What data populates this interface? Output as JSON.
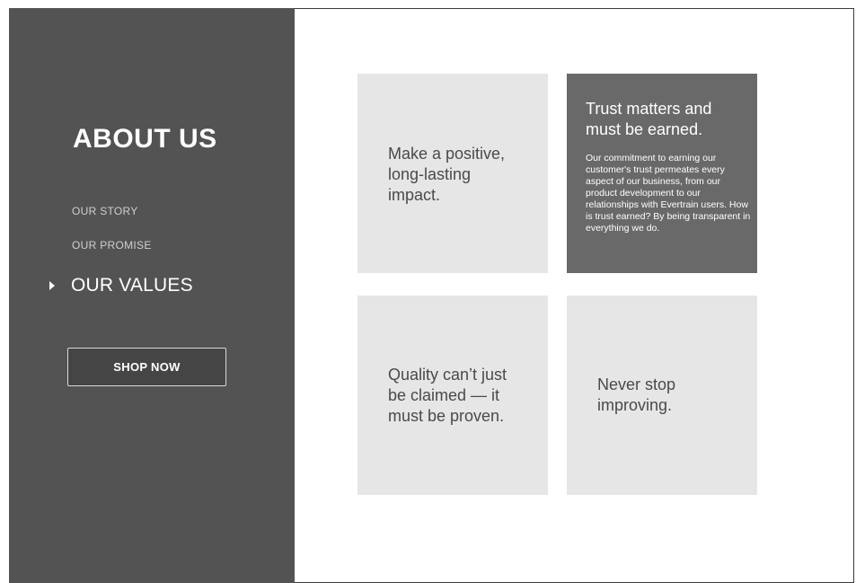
{
  "sidebar": {
    "title": "ABOUT US",
    "nav": [
      {
        "label": "OUR STORY"
      },
      {
        "label": "OUR PROMISE"
      },
      {
        "label": "OUR VALUES",
        "active": true
      }
    ],
    "cta_label": "SHOP NOW"
  },
  "values": [
    {
      "text": "Make a positive,\nlong-lasting\nimpact."
    },
    {
      "heading": "Trust matters and\nmust be earned.",
      "body": "Our commitment to earning our customer's trust permeates every aspect of our business, from our product development to our relationships with Evertrain users. How is trust earned? By being transparent in everything we do."
    },
    {
      "text": "Quality can’t just\nbe claimed — it\nmust be proven."
    },
    {
      "text": "Never stop\nimproving."
    }
  ],
  "colors": {
    "sidebar_bg": "#535353",
    "card_bg": "#e6e6e6",
    "card_highlight_bg": "#696969"
  },
  "icons": {
    "active_nav": "caret-right-icon"
  }
}
